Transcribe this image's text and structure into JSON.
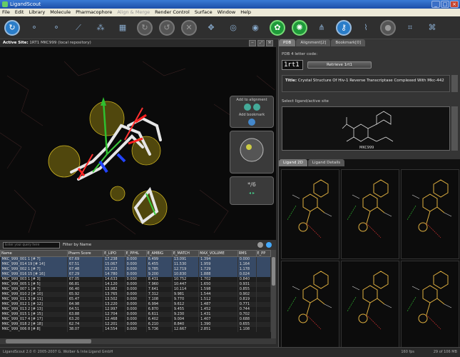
{
  "window": {
    "title": "LigandScout",
    "controls": [
      "_",
      "□",
      "×"
    ]
  },
  "menu": [
    "File",
    "Edit",
    "Library",
    "Molecule",
    "Pharmacophore",
    "Align & Merge",
    "Render Control",
    "Surface",
    "Window",
    "Help"
  ],
  "menu_disabled": [
    "Align & Merge"
  ],
  "toolbar": {
    "icons": [
      {
        "name": "back-arrow-icon",
        "glyph": "↻",
        "style": "blue"
      },
      {
        "name": "molecule-icon",
        "glyph": "⚬",
        "style": "plain"
      },
      {
        "name": "molecule-icon-2",
        "glyph": "⚬",
        "style": "plain"
      },
      {
        "name": "bond-icon",
        "glyph": "⟋",
        "style": "plain"
      },
      {
        "name": "pharmacophore-icon",
        "glyph": "⁂",
        "style": "plain"
      },
      {
        "name": "layer-icon",
        "glyph": "▦",
        "style": "plain"
      },
      {
        "name": "rotate-icon",
        "glyph": "↻",
        "style": "grey"
      },
      {
        "name": "rotate-icon-2",
        "glyph": "↺",
        "style": "grey"
      },
      {
        "name": "cancel-icon",
        "glyph": "✕",
        "style": "grey"
      },
      {
        "name": "move-icon",
        "glyph": "✥",
        "style": "plain"
      },
      {
        "name": "target-icon",
        "glyph": "◎",
        "style": "plain"
      },
      {
        "name": "target-icon-2",
        "glyph": "◉",
        "style": "plain"
      },
      {
        "name": "flower-icon",
        "glyph": "✿",
        "style": "green"
      },
      {
        "name": "sun-icon",
        "glyph": "✺",
        "style": "green"
      },
      {
        "name": "network-icon",
        "glyph": "⋔",
        "style": "plain"
      },
      {
        "name": "key-icon",
        "glyph": "⚷",
        "style": "blue"
      },
      {
        "name": "dna-icon",
        "glyph": "⌇",
        "style": "plain"
      },
      {
        "name": "disabled-icon",
        "glyph": "●",
        "style": "grey"
      },
      {
        "name": "align-icon",
        "glyph": "⌗",
        "style": "plain"
      },
      {
        "name": "merge-icon",
        "glyph": "⌘",
        "style": "plain"
      }
    ]
  },
  "active_site": {
    "label": "Active Site:",
    "value": "1RT1 MKC999",
    "repo": "(local repository)"
  },
  "viewer_panel": {
    "add_alignment": "Add to alignment",
    "add_bookmark": "Add bookmark",
    "counter": "*/6"
  },
  "list": {
    "search_placeholder": "Enter your query here",
    "filter": "Filter by Name",
    "columns": [
      "Name",
      "Pharm Score",
      "E_LIPO",
      "E_PPHL",
      "E_AMBIG",
      "E_MATCH",
      "MAX_VOLUME",
      "RMS",
      "E_PP"
    ],
    "rows": [
      [
        "MKC_999_001 1 [# 7]",
        "67.69",
        "17.238",
        "0.000",
        "6.499",
        "13.091",
        "1.394",
        "0.000",
        ""
      ],
      [
        "MKC_999_014 19 [# 14]",
        "67.51",
        "15.067",
        "0.000",
        "6.455",
        "11.530",
        "1.959",
        "1.164",
        ""
      ],
      [
        "MKC_999_002 1 [# 7]",
        "67.48",
        "15.223",
        "0.000",
        "9.785",
        "12.719",
        "1.729",
        "1.178",
        ""
      ],
      [
        "MKC_999_016 15 [# 16]",
        "67.29",
        "14.780",
        "0.000",
        "9.200",
        "10.830",
        "1.888",
        "0.024",
        ""
      ],
      [
        "MKC_999_003 1 [# 3]",
        "67.05",
        "14.633",
        "0.000",
        "8.431",
        "10.752",
        "1.702",
        "0.840",
        ""
      ],
      [
        "MKC_999_005 1 [# 5]",
        "66.81",
        "14.120",
        "0.000",
        "7.960",
        "10.447",
        "1.650",
        "0.931",
        ""
      ],
      [
        "MKC_999_007 1 [# 7]",
        "66.40",
        "13.982",
        "0.000",
        "7.641",
        "10.114",
        "1.598",
        "0.855",
        ""
      ],
      [
        "MKC_999_010 2 [# 10]",
        "65.92",
        "13.765",
        "0.000",
        "7.312",
        "9.981",
        "1.544",
        "0.902",
        ""
      ],
      [
        "MKC_999_011 3 [# 11]",
        "65.47",
        "13.502",
        "0.000",
        "7.108",
        "9.770",
        "1.512",
        "0.819",
        ""
      ],
      [
        "MKC_999_012 1 [# 12]",
        "64.98",
        "13.220",
        "0.000",
        "6.994",
        "9.612",
        "1.487",
        "0.771",
        ""
      ],
      [
        "MKC_999_013 2 [# 13]",
        "64.51",
        "12.997",
        "0.000",
        "6.870",
        "9.455",
        "1.452",
        "0.744",
        ""
      ],
      [
        "MKC_999_015 1 [# 15]",
        "63.88",
        "12.704",
        "0.000",
        "6.611",
        "9.230",
        "1.431",
        "0.702",
        ""
      ],
      [
        "MKC_999_017 4 [# 17]",
        "63.20",
        "12.468",
        "0.000",
        "6.402",
        "9.004",
        "1.407",
        "0.688",
        ""
      ],
      [
        "MKC_999_018 2 [# 18]",
        "62.74",
        "12.201",
        "0.000",
        "6.210",
        "8.840",
        "1.390",
        "0.655",
        ""
      ],
      [
        "MKC_999_006 8 [# 8]",
        "38.07",
        "14.554",
        "0.000",
        "5.736",
        "12.667",
        "2.851",
        "1.108",
        ""
      ]
    ]
  },
  "status": {
    "left": "LigandScout 2.0 © 2005-2007 G. Wolber & Inte:Ligand GmbH",
    "fps": "160 fps",
    "memory": "29 of 106 MB"
  },
  "pdb_panel": {
    "tabs": [
      "PDB",
      "Alignment[2]",
      "Bookmark[0]"
    ],
    "code_label": "PDB 4 letter code:",
    "code": "1rt1",
    "retrieve": "Retrieve 1rt1",
    "title_label": "Title:",
    "title": "Crystal Structure Of Hiv-1 Reverse Transcriptase Complexed With Mkc-442",
    "select_label": "Select ligand/active site",
    "ligand_name": "MKC999"
  },
  "ligand_panel": {
    "tabs": [
      "Ligand 2D",
      "Ligand Details"
    ]
  },
  "colors": {
    "accent_blue": "#2a7dc9",
    "green": "#1f9b3a",
    "highlight": "#e0b040"
  }
}
